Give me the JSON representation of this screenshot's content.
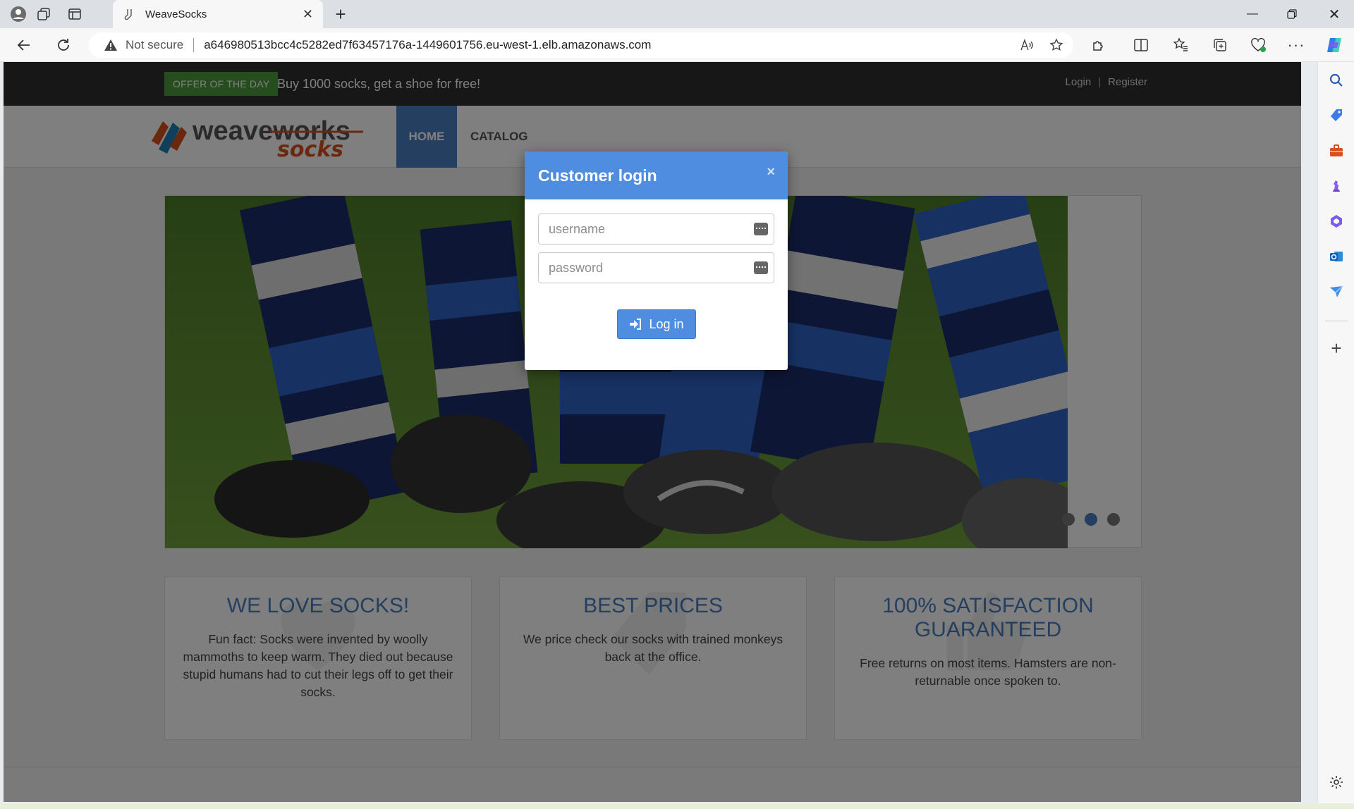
{
  "browser": {
    "tab_title": "WeaveSocks",
    "not_secure_label": "Not secure",
    "url": "a646980513bcc4c5282ed7f63457176a-1449601756.eu-west-1.elb.amazonaws.com"
  },
  "topbar": {
    "offer_badge": "OFFER OF THE DAY",
    "offer_text": "Buy 1000 socks, get a shoe for free!",
    "login_link": "Login",
    "separator": "|",
    "register_link": "Register"
  },
  "header": {
    "logo_text_1": "weaveworks",
    "logo_text_2": "socks",
    "menu": {
      "home": "HOME",
      "catalogue": "CATALOG"
    }
  },
  "slider": {
    "dot_count": 3,
    "active_dot": 2
  },
  "features": [
    {
      "title": "WE LOVE SOCKS!",
      "text": "Fun fact: Socks were invented by woolly mammoths to keep warm. They died out because stupid humans had to cut their legs off to get their socks."
    },
    {
      "title": "BEST PRICES",
      "text": "We price check our socks with trained monkeys back at the office."
    },
    {
      "title": "100% SATISFACTION GUARANTEED",
      "text": "Free returns on most items. Hamsters are non-returnable once spoken to."
    }
  ],
  "modal": {
    "title": "Customer login",
    "close_glyph": "×",
    "username_placeholder": "username",
    "password_placeholder": "password",
    "login_button": "Log in"
  },
  "colors": {
    "accent": "#4f8de0",
    "menu_active": "#4b7fc3",
    "offer_green": "#4d9a3c",
    "topbar": "#2f2f2f"
  }
}
